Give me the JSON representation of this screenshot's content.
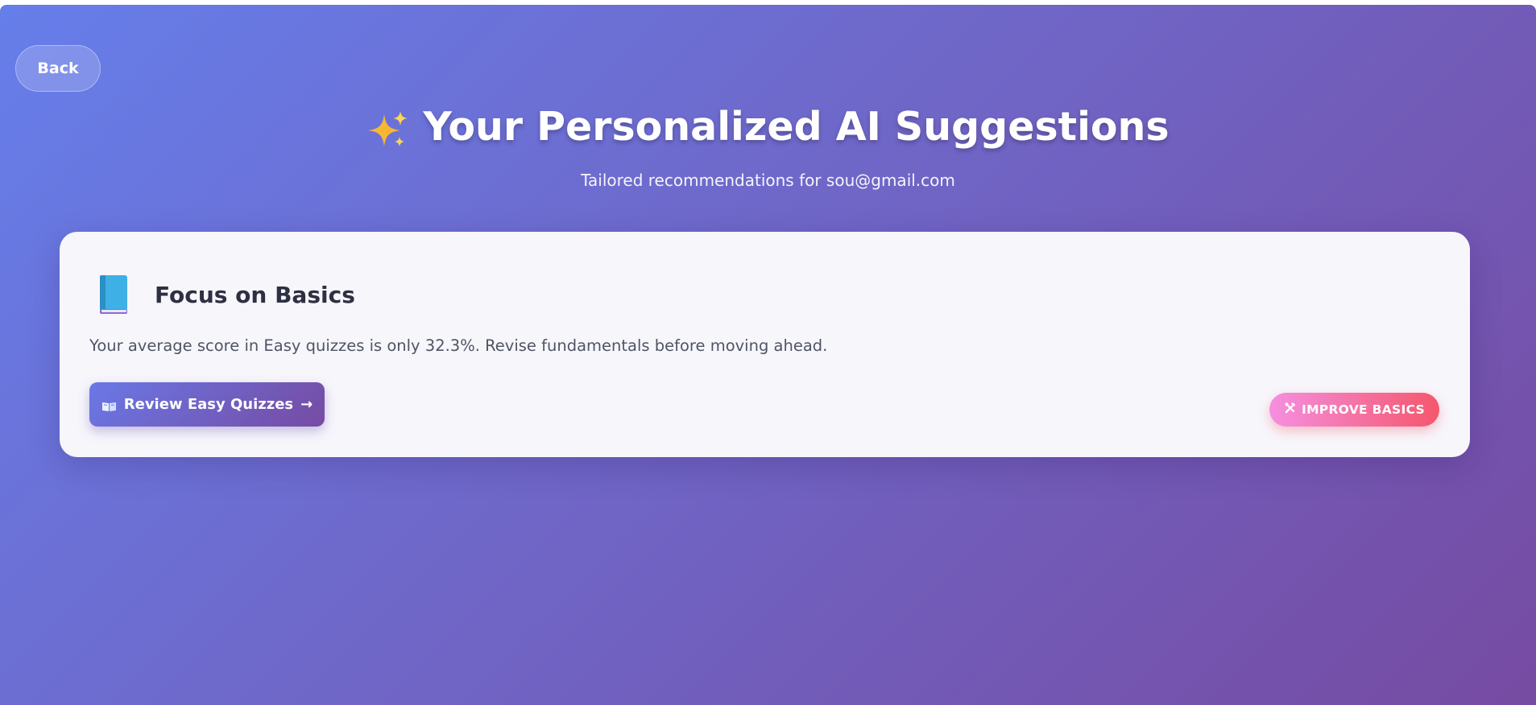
{
  "nav": {
    "back_label": "Back"
  },
  "header": {
    "title_icon": "sparkles-icon",
    "title": "Your Personalized AI Suggestions",
    "subtitle": "Tailored recommendations for sou@gmail.com"
  },
  "suggestion": {
    "icon": "blue-book-icon",
    "title": "Focus on Basics",
    "description": "Your average score in Easy quizzes is only 32.3%. Revise fundamentals before moving ahead.",
    "action_icon": "open-book-icon",
    "action_label": "Review Easy Quizzes",
    "action_arrow": "→",
    "badge_icon": "tools-icon",
    "badge_label": "IMPROVE BASICS"
  },
  "colors": {
    "background_start": "#667eea",
    "background_end": "#764ba2",
    "badge_start": "#f58fe0",
    "badge_end": "#f5576c"
  }
}
